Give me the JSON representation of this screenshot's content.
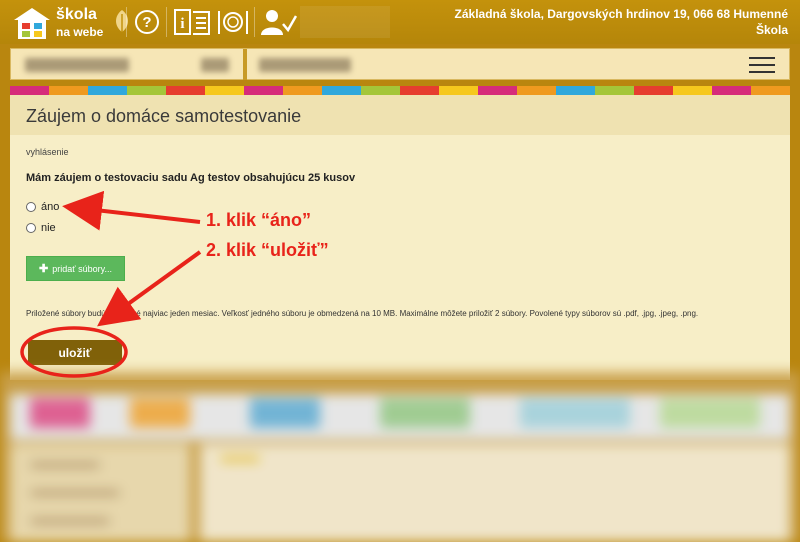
{
  "header": {
    "logo_line1": "škola",
    "logo_line2": "na webe",
    "school_line1": "Základná škola, Dargovských hrdinov 19, 066 68 Humenné",
    "school_line2": "Škola",
    "nav_icons": [
      "help-icon",
      "gradebook-icon",
      "lunch-icon",
      "teacher-icon"
    ]
  },
  "userbar": {
    "menu_icon": "hamburger-icon"
  },
  "stripe_colors": [
    "#d62c7a",
    "#ef9a1f",
    "#30a8dc",
    "#a4c639",
    "#e63d2f",
    "#f6c81d",
    "#d62c7a",
    "#ef9a1f",
    "#30a8dc",
    "#a4c639",
    "#e63d2f",
    "#f6c81d",
    "#d62c7a",
    "#ef9a1f",
    "#30a8dc",
    "#a4c639",
    "#e63d2f",
    "#f6c81d",
    "#d62c7a",
    "#ef9a1f"
  ],
  "form": {
    "title": "Záujem o domáce samotestovanie",
    "subtitle": "vyhlásenie",
    "question": "Mám záujem o testovaciu sadu Ag testov obsahujúcu 25 kusov",
    "options": [
      "áno",
      "nie"
    ],
    "add_files_label": "pridať súbory...",
    "note": "Priložené súbory budú dostupné najviac jeden mesiac. Veľkosť jedného súboru je obmedzená na 10 MB. Maximálne môžete priložiť 2 súbory. Povolené typy súborov sú .pdf, .jpg, .jpeg, .png.",
    "save_label": "uložiť"
  },
  "annotations": {
    "step1": "1. klik “áno”",
    "step2": "2. klik “uložiť”",
    "color": "#e8231a"
  }
}
